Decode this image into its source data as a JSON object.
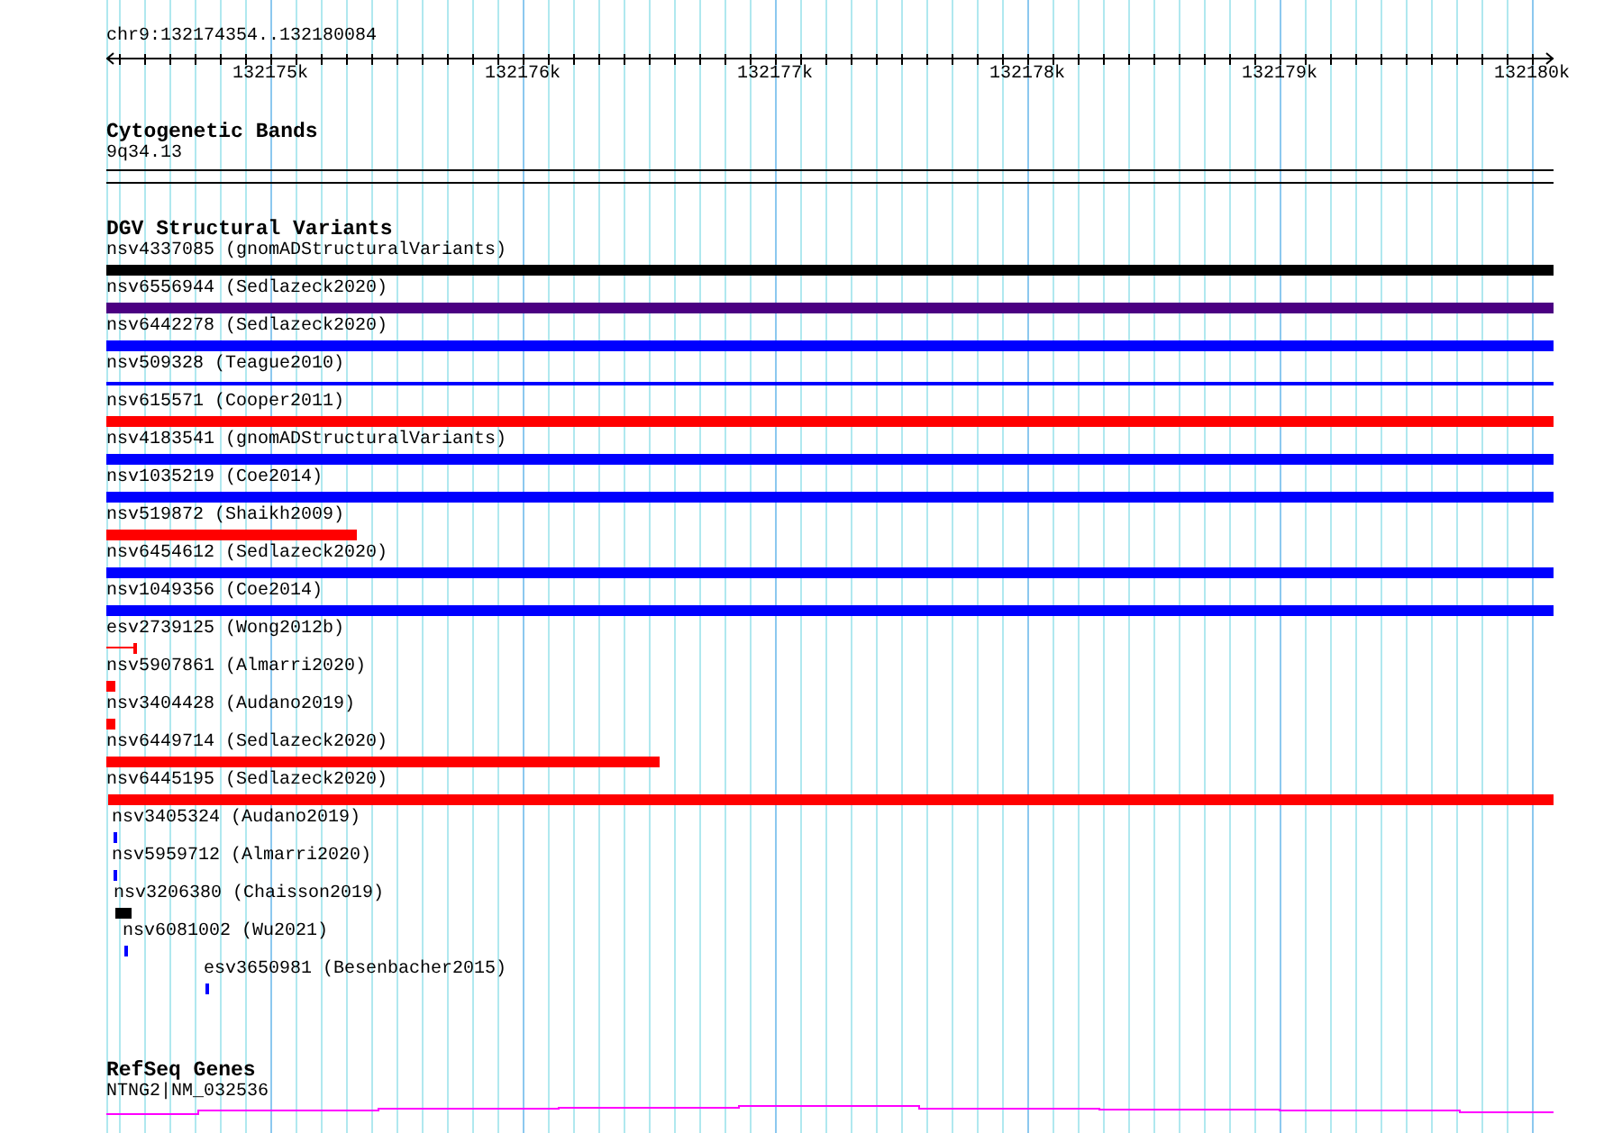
{
  "ruler": {
    "location": "chr9:132174354..132180084",
    "ticks": [
      "132175k",
      "132176k",
      "132177k",
      "132178k",
      "132179k",
      "132180k"
    ]
  },
  "cytogenetic_bands": {
    "title": "Cytogenetic Bands",
    "band": "9q34.13"
  },
  "dgv_structural_variants": {
    "title": "DGV Structural Variants",
    "features": [
      {
        "label": "nsv4337085 (gnomADStructuralVariants)",
        "kind": "bar",
        "color": "#000000"
      },
      {
        "label": "nsv6556944 (Sedlazeck2020)",
        "kind": "bar",
        "color": "#4b0082"
      },
      {
        "label": "nsv6442278 (Sedlazeck2020)",
        "kind": "bar",
        "color": "#0000ff"
      },
      {
        "label": "nsv509328 (Teague2010)",
        "kind": "line",
        "color": "#0000ff"
      },
      {
        "label": "nsv615571 (Cooper2011)",
        "kind": "bar",
        "color": "#ff0000"
      },
      {
        "label": "nsv4183541 (gnomADStructuralVariants)",
        "kind": "bar",
        "color": "#0000ff"
      },
      {
        "label": "nsv1035219 (Coe2014)",
        "kind": "bar",
        "color": "#0000ff"
      },
      {
        "label": "nsv519872 (Shaikh2009)",
        "kind": "bar",
        "color": "#ff0000"
      },
      {
        "label": "nsv6454612 (Sedlazeck2020)",
        "kind": "bar",
        "color": "#0000ff"
      },
      {
        "label": "nsv1049356 (Coe2014)",
        "kind": "bar",
        "color": "#0000ff"
      },
      {
        "label": "esv2739125 (Wong2012b)",
        "kind": "whisker",
        "color": "#ff0000"
      },
      {
        "label": "nsv5907861 (Almarri2020)",
        "kind": "bar",
        "color": "#ff0000"
      },
      {
        "label": "nsv3404428 (Audano2019)",
        "kind": "bar",
        "color": "#ff0000"
      },
      {
        "label": "nsv6449714 (Sedlazeck2020)",
        "kind": "bar",
        "color": "#ff0000"
      },
      {
        "label": "nsv6445195 (Sedlazeck2020)",
        "kind": "bar",
        "color": "#ff0000"
      },
      {
        "label": "nsv3405324 (Audano2019)",
        "kind": "bar",
        "color": "#0000ff"
      },
      {
        "label": "nsv5959712 (Almarri2020)",
        "kind": "bar",
        "color": "#0000ff"
      },
      {
        "label": "nsv3206380 (Chaisson2019)",
        "kind": "bar",
        "color": "#000000"
      },
      {
        "label": "nsv6081002 (Wu2021)",
        "kind": "bar",
        "color": "#0000ff"
      },
      {
        "label": "esv3650981 (Besenbacher2015)",
        "kind": "bar",
        "color": "#0000ff"
      }
    ]
  },
  "refseq_genes": {
    "title": "RefSeq Genes",
    "gene": "NTNG2|NM_032536"
  }
}
